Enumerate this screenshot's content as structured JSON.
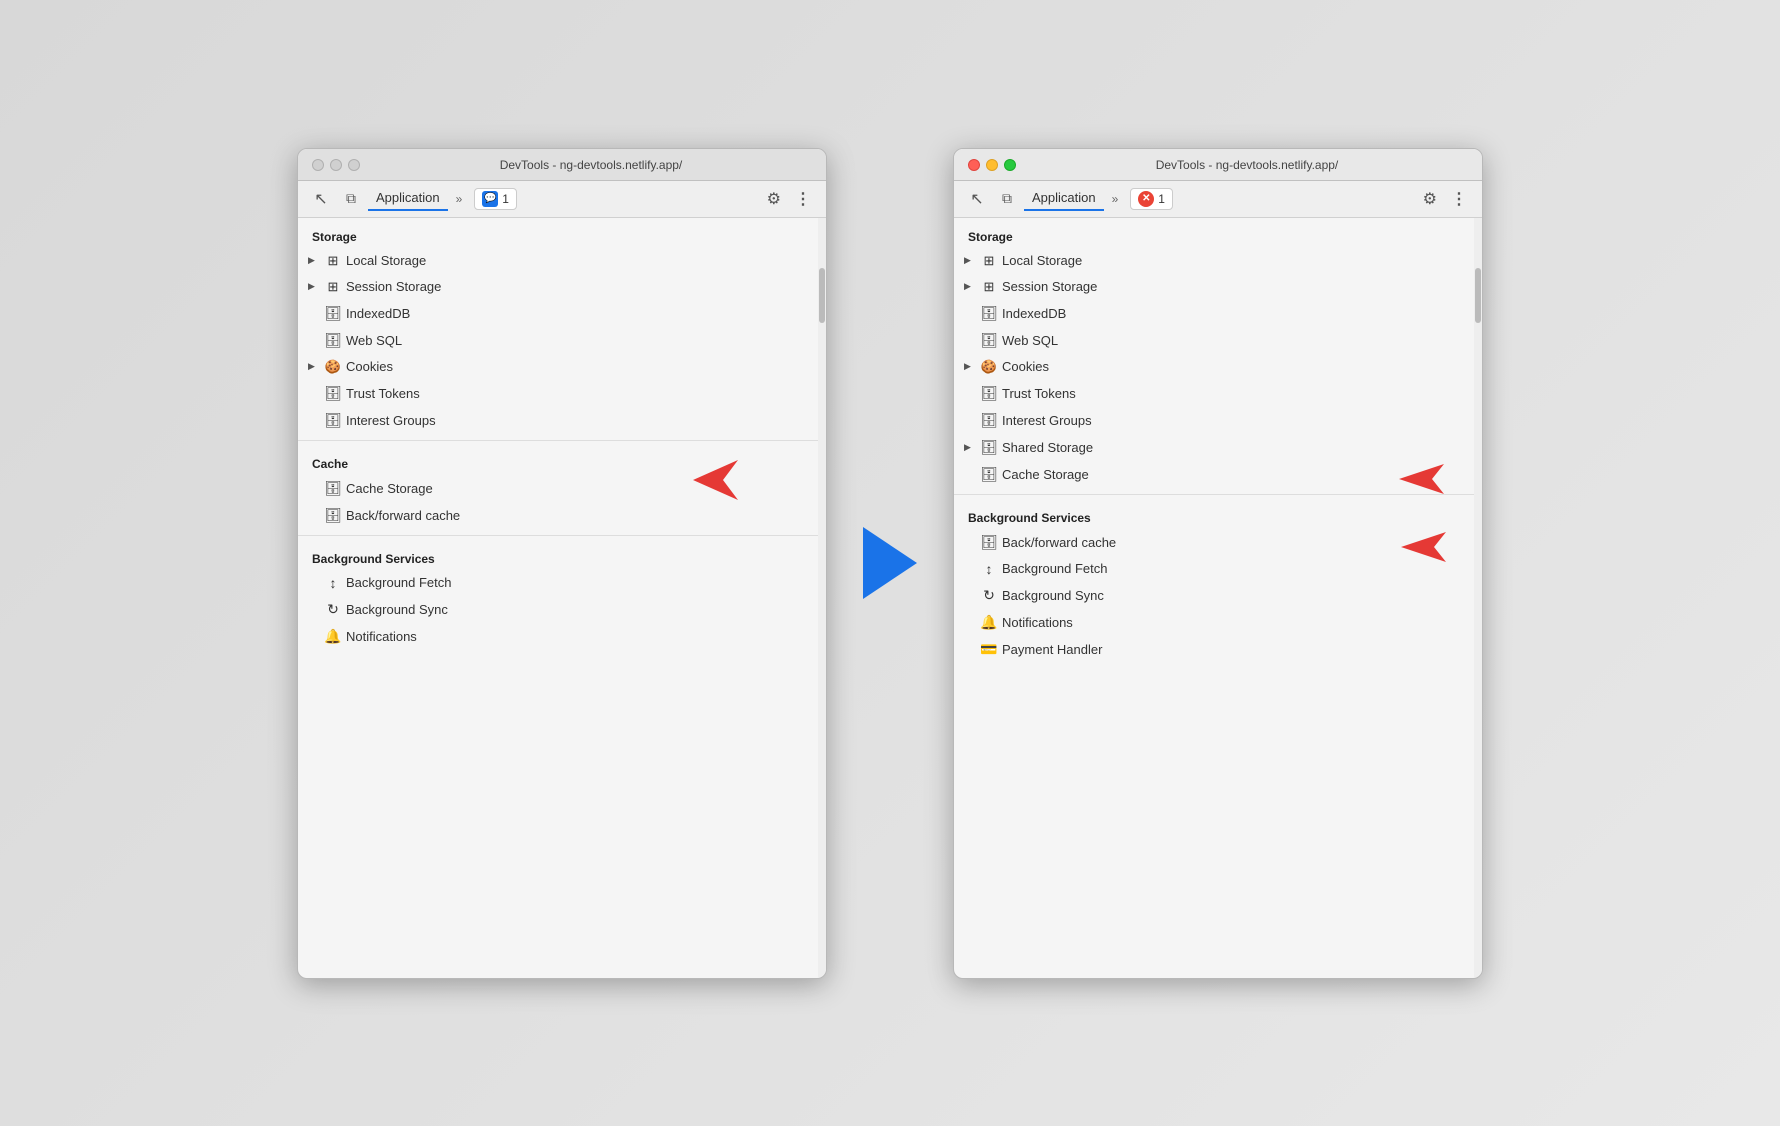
{
  "page": {
    "background": "#e0e0e0"
  },
  "left_window": {
    "title": "DevTools - ng-devtools.netlify.app/",
    "traffic_lights": "inactive",
    "toolbar": {
      "inspect_icon": "⬡",
      "layers_icon": "⬜",
      "tab_label": "Application",
      "chevron": "»",
      "badge_label": "1",
      "badge_type": "blue",
      "gear_icon": "⚙",
      "more_icon": "⋮"
    },
    "storage_section": "Storage",
    "items": [
      {
        "label": "Local Storage",
        "icon": "⊞",
        "expandable": true,
        "indent": 1
      },
      {
        "label": "Session Storage",
        "icon": "⊞",
        "expandable": true,
        "indent": 1
      },
      {
        "label": "IndexedDB",
        "icon": "🗄",
        "expandable": false,
        "indent": 2
      },
      {
        "label": "Web SQL",
        "icon": "🗄",
        "expandable": false,
        "indent": 2
      },
      {
        "label": "Cookies",
        "icon": "🍪",
        "expandable": true,
        "indent": 1
      },
      {
        "label": "Trust Tokens",
        "icon": "🗄",
        "expandable": false,
        "indent": 2
      },
      {
        "label": "Interest Groups",
        "icon": "🗄",
        "expandable": false,
        "indent": 2
      }
    ],
    "cache_section": "Cache",
    "cache_items": [
      {
        "label": "Cache Storage",
        "icon": "🗄",
        "expandable": false,
        "indent": 2
      },
      {
        "label": "Back/forward cache",
        "icon": "🗄",
        "expandable": false,
        "indent": 2
      }
    ],
    "bg_section": "Background Services",
    "bg_items": [
      {
        "label": "Background Fetch",
        "icon": "↕",
        "expandable": false,
        "indent": 2
      },
      {
        "label": "Background Sync",
        "icon": "↻",
        "expandable": false,
        "indent": 2
      },
      {
        "label": "Notifications",
        "icon": "🔔",
        "expandable": false,
        "indent": 2
      }
    ],
    "annotation_cache": "red-arrow-cache",
    "annotation_cache_position": "Cache section"
  },
  "right_window": {
    "title": "DevTools - ng-devtools.netlify.app/",
    "traffic_lights": "active",
    "toolbar": {
      "tab_label": "Application",
      "chevron": "»",
      "badge_label": "1",
      "badge_type": "red",
      "gear_icon": "⚙",
      "more_icon": "⋮"
    },
    "storage_section": "Storage",
    "items": [
      {
        "label": "Local Storage",
        "icon": "⊞",
        "expandable": true,
        "indent": 1
      },
      {
        "label": "Session Storage",
        "icon": "⊞",
        "expandable": true,
        "indent": 1
      },
      {
        "label": "IndexedDB",
        "icon": "🗄",
        "expandable": false,
        "indent": 2
      },
      {
        "label": "Web SQL",
        "icon": "🗄",
        "expandable": false,
        "indent": 2
      },
      {
        "label": "Cookies",
        "icon": "🍪",
        "expandable": true,
        "indent": 1
      },
      {
        "label": "Trust Tokens",
        "icon": "🗄",
        "expandable": false,
        "indent": 2
      },
      {
        "label": "Interest Groups",
        "icon": "🗄",
        "expandable": false,
        "indent": 2
      },
      {
        "label": "Shared Storage",
        "icon": "🗄",
        "expandable": true,
        "indent": 1
      },
      {
        "label": "Cache Storage",
        "icon": "🗄",
        "expandable": false,
        "indent": 2
      }
    ],
    "bg_section": "Background Services",
    "bg_items": [
      {
        "label": "Back/forward cache",
        "icon": "🗄",
        "expandable": false,
        "indent": 2
      },
      {
        "label": "Background Fetch",
        "icon": "↕",
        "expandable": false,
        "indent": 2
      },
      {
        "label": "Background Sync",
        "icon": "↻",
        "expandable": false,
        "indent": 2
      },
      {
        "label": "Notifications",
        "icon": "🔔",
        "expandable": false,
        "indent": 2
      },
      {
        "label": "Payment Handler",
        "icon": "💳",
        "expandable": false,
        "indent": 2
      }
    ]
  },
  "icons": {
    "cursor": "↖",
    "layers": "⧉",
    "gear": "⚙",
    "more": "⋮",
    "chevron_right": "▶",
    "db_icon": "≡",
    "cookie_icon": "◎",
    "bell_icon": "🔔",
    "sync_icon": "↻",
    "fetch_icon": "↕",
    "storage_icon": "⊞",
    "card_icon": "▬"
  }
}
